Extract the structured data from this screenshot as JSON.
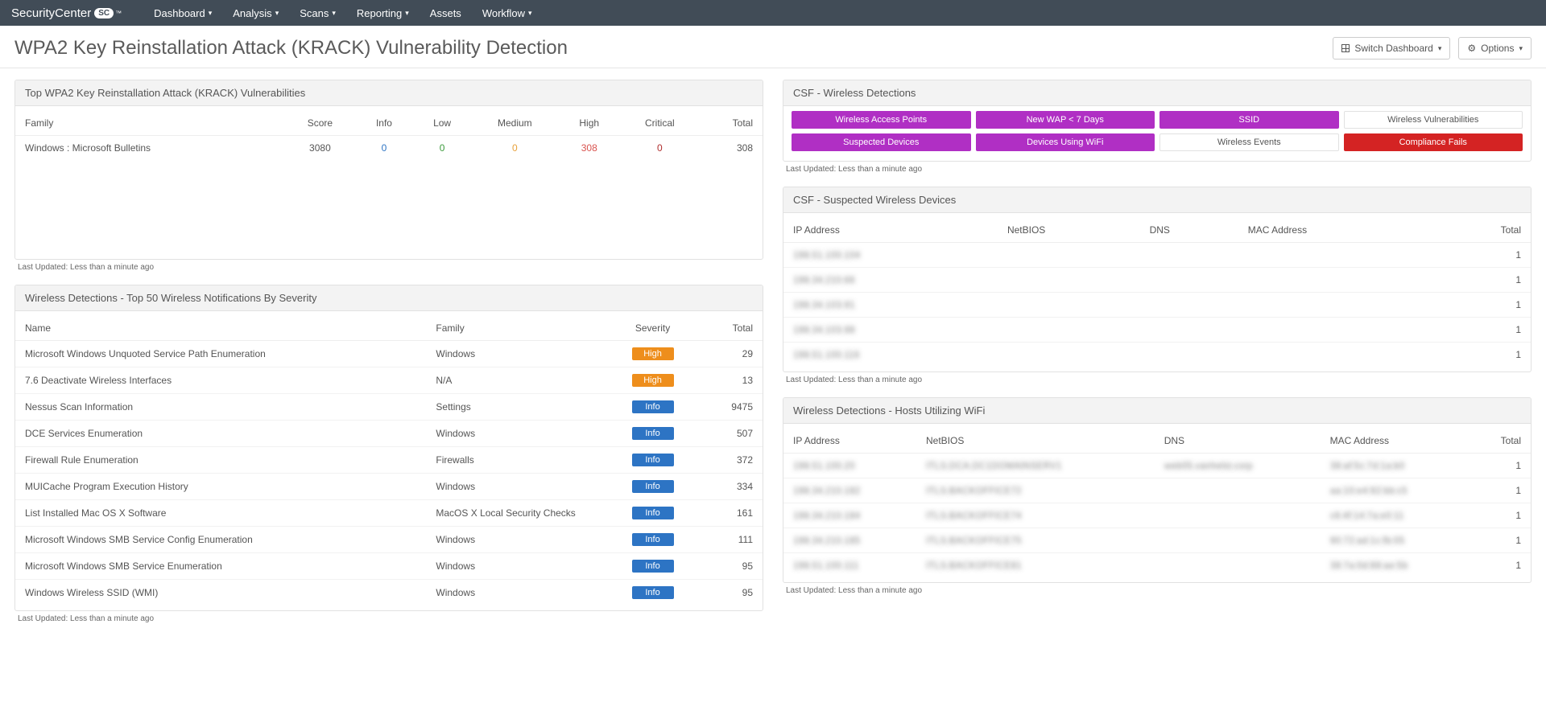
{
  "brand": {
    "name": "SecurityCenter",
    "pill": "SC"
  },
  "nav": {
    "dashboard": "Dashboard",
    "analysis": "Analysis",
    "scans": "Scans",
    "reporting": "Reporting",
    "assets": "Assets",
    "workflow": "Workflow"
  },
  "page": {
    "title": "WPA2 Key Reinstallation Attack (KRACK) Vulnerability Detection",
    "switch_dashboard": "Switch Dashboard",
    "options": "Options"
  },
  "last_updated": "Last Updated: Less than a minute ago",
  "panels": {
    "top_krack": {
      "title": "Top WPA2 Key Reinstallation Attack (KRACK) Vulnerabilities",
      "headers": {
        "family": "Family",
        "score": "Score",
        "info": "Info",
        "low": "Low",
        "medium": "Medium",
        "high": "High",
        "critical": "Critical",
        "total": "Total"
      },
      "rows": [
        {
          "family": "Windows : Microsoft Bulletins",
          "score": "3080",
          "info": "0",
          "low": "0",
          "medium": "0",
          "high": "308",
          "critical": "0",
          "total": "308"
        }
      ]
    },
    "top50": {
      "title": "Wireless Detections - Top 50 Wireless Notifications By Severity",
      "headers": {
        "name": "Name",
        "family": "Family",
        "severity": "Severity",
        "total": "Total"
      },
      "rows": [
        {
          "name": "Microsoft Windows Unquoted Service Path Enumeration",
          "family": "Windows",
          "severity": "High",
          "sev_class": "sev-high",
          "total": "29"
        },
        {
          "name": "7.6 Deactivate Wireless Interfaces",
          "family": "N/A",
          "severity": "High",
          "sev_class": "sev-high",
          "total": "13"
        },
        {
          "name": "Nessus Scan Information",
          "family": "Settings",
          "severity": "Info",
          "sev_class": "sev-info",
          "total": "9475"
        },
        {
          "name": "DCE Services Enumeration",
          "family": "Windows",
          "severity": "Info",
          "sev_class": "sev-info",
          "total": "507"
        },
        {
          "name": "Firewall Rule Enumeration",
          "family": "Firewalls",
          "severity": "Info",
          "sev_class": "sev-info",
          "total": "372"
        },
        {
          "name": "MUICache Program Execution History",
          "family": "Windows",
          "severity": "Info",
          "sev_class": "sev-info",
          "total": "334"
        },
        {
          "name": "List Installed Mac OS X Software",
          "family": "MacOS X Local Security Checks",
          "severity": "Info",
          "sev_class": "sev-info",
          "total": "161"
        },
        {
          "name": "Microsoft Windows SMB Service Config Enumeration",
          "family": "Windows",
          "severity": "Info",
          "sev_class": "sev-info",
          "total": "111"
        },
        {
          "name": "Microsoft Windows SMB Service Enumeration",
          "family": "Windows",
          "severity": "Info",
          "sev_class": "sev-info",
          "total": "95"
        },
        {
          "name": "Windows Wireless SSID (WMI)",
          "family": "Windows",
          "severity": "Info",
          "sev_class": "sev-info",
          "total": "95"
        }
      ]
    },
    "csf_matrix": {
      "title": "CSF - Wireless Detections",
      "tiles": [
        {
          "label": "Wireless Access Points",
          "cls": "purple"
        },
        {
          "label": "New WAP < 7 Days",
          "cls": "purple"
        },
        {
          "label": "SSID",
          "cls": "purple"
        },
        {
          "label": "Wireless Vulnerabilities",
          "cls": ""
        },
        {
          "label": "Suspected Devices",
          "cls": "purple"
        },
        {
          "label": "Devices Using WiFi",
          "cls": "purple"
        },
        {
          "label": "Wireless Events",
          "cls": ""
        },
        {
          "label": "Compliance Fails",
          "cls": "red"
        }
      ]
    },
    "suspected": {
      "title": "CSF - Suspected Wireless Devices",
      "headers": {
        "ip": "IP Address",
        "netbios": "NetBIOS",
        "dns": "DNS",
        "mac": "MAC Address",
        "total": "Total"
      },
      "rows": [
        {
          "ip": "198.51.100.104",
          "netbios": "",
          "dns": "",
          "mac": "",
          "total": "1"
        },
        {
          "ip": "198.34.210.66",
          "netbios": "",
          "dns": "",
          "mac": "",
          "total": "1"
        },
        {
          "ip": "198.34.103.91",
          "netbios": "",
          "dns": "",
          "mac": "",
          "total": "1"
        },
        {
          "ip": "198.34.103.98",
          "netbios": "",
          "dns": "",
          "mac": "",
          "total": "1"
        },
        {
          "ip": "198.51.100.116",
          "netbios": "",
          "dns": "",
          "mac": "",
          "total": "1"
        }
      ]
    },
    "hosts_wifi": {
      "title": "Wireless Detections - Hosts Utilizing WiFi",
      "headers": {
        "ip": "IP Address",
        "netbios": "NetBIOS",
        "dns": "DNS",
        "mac": "MAC Address",
        "total": "Total"
      },
      "rows": [
        {
          "ip": "198.51.100.20",
          "netbios": "ITLS.DCA.DC1DOMAINSERV1",
          "dns": "web05.vanhelst.corp",
          "mac": "38:af:5c:7d:1a:b0",
          "total": "1"
        },
        {
          "ip": "198.34.210.182",
          "netbios": "ITLS.BACKOFFICE72",
          "dns": "",
          "mac": "aa:10:e4:92:bb:c5",
          "total": "1"
        },
        {
          "ip": "198.34.210.184",
          "netbios": "ITLS.BACKOFFICE74",
          "dns": "",
          "mac": "c6:4f:14:7a:e0:11",
          "total": "1"
        },
        {
          "ip": "198.34.210.185",
          "netbios": "ITLS.BACKOFFICE75",
          "dns": "",
          "mac": "90:72:ad:1c:fb:05",
          "total": "1"
        },
        {
          "ip": "198.51.100.111",
          "netbios": "ITLS.BACKOFFICE81",
          "dns": "",
          "mac": "38:7a:0d:88:ae:5b",
          "total": "1"
        }
      ]
    }
  }
}
